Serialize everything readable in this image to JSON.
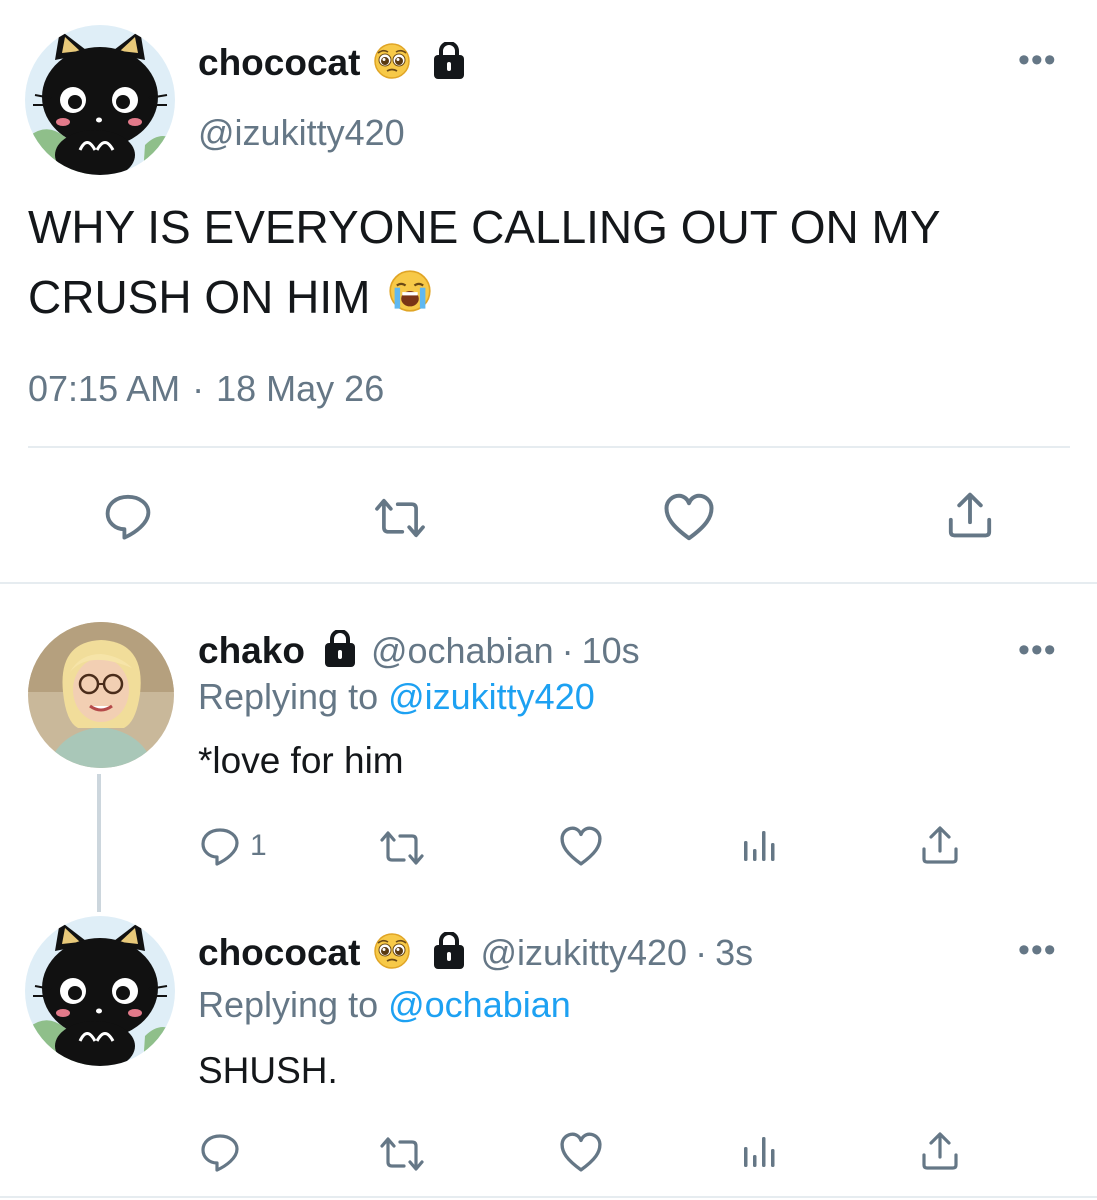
{
  "main_tweet": {
    "display_name": "chococat",
    "emoji": "pleading-face",
    "handle": "@izukitty420",
    "text_line1": "WHY IS EVERYONE CALLING OUT ON MY",
    "text_line2": "CRUSH ON HIM",
    "text_emoji": "loudly-crying-face",
    "time": "07:15 AM",
    "date": "18 May 26",
    "dot": "·"
  },
  "replies": [
    {
      "display_name": "chako",
      "handle": "@ochabian",
      "time_ago": "10s",
      "replying_label": "Replying to",
      "replying_to": "@izukitty420",
      "text": "*love for him",
      "reply_count": "1"
    },
    {
      "display_name": "chococat",
      "emoji": "pleading-face",
      "handle": "@izukitty420",
      "time_ago": "3s",
      "replying_label": "Replying to",
      "replying_to": "@ochabian",
      "text": "SHUSH.",
      "reply_count": ""
    }
  ],
  "colors": {
    "link": "#1da1f2",
    "muted": "#657786",
    "divider": "#e6ecf0"
  }
}
